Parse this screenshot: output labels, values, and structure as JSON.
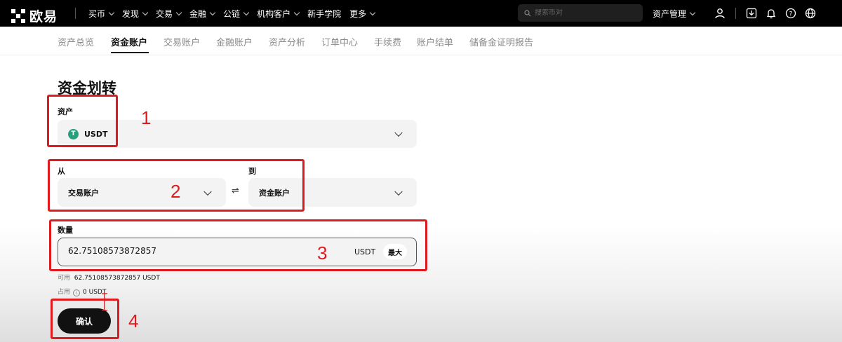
{
  "topbar": {
    "logo_text": "欧易",
    "nav": [
      "买币",
      "发现",
      "交易",
      "金融",
      "公链",
      "机构客户",
      "新手学院",
      "更多"
    ],
    "nav_has_dropdown": [
      true,
      true,
      true,
      true,
      true,
      true,
      false,
      true
    ],
    "search_placeholder": "搜索币对",
    "asset_management": "资产管理",
    "icons": [
      "user-icon",
      "download-icon",
      "bell-icon",
      "help-icon",
      "globe-icon"
    ]
  },
  "subnav": {
    "tabs": [
      "资产总览",
      "资金账户",
      "交易账户",
      "金融账户",
      "资产分析",
      "订单中心",
      "手续费",
      "账户结单",
      "储备金证明报告"
    ],
    "active_index": 1
  },
  "transfer": {
    "title": "资金划转",
    "asset_label": "资产",
    "asset_value": "USDT",
    "asset_icon_letter": "T",
    "from_label": "从",
    "from_value": "交易账户",
    "to_label": "到",
    "to_value": "资金账户",
    "swap_symbol": "⇌",
    "amount_label": "数量",
    "amount_value": "62.75108573872857",
    "amount_unit": "USDT",
    "max_label": "最大",
    "available_label": "可用",
    "available_value": "62.75108573872857 USDT",
    "occupied_label": "占用",
    "occupied_value": "0 USDT",
    "confirm_label": "确认"
  },
  "annotations": [
    "1",
    "2",
    "3",
    "4"
  ],
  "colors": {
    "annotation": "#e0191e",
    "usdt": "#26a17b",
    "topbar": "#000000"
  }
}
